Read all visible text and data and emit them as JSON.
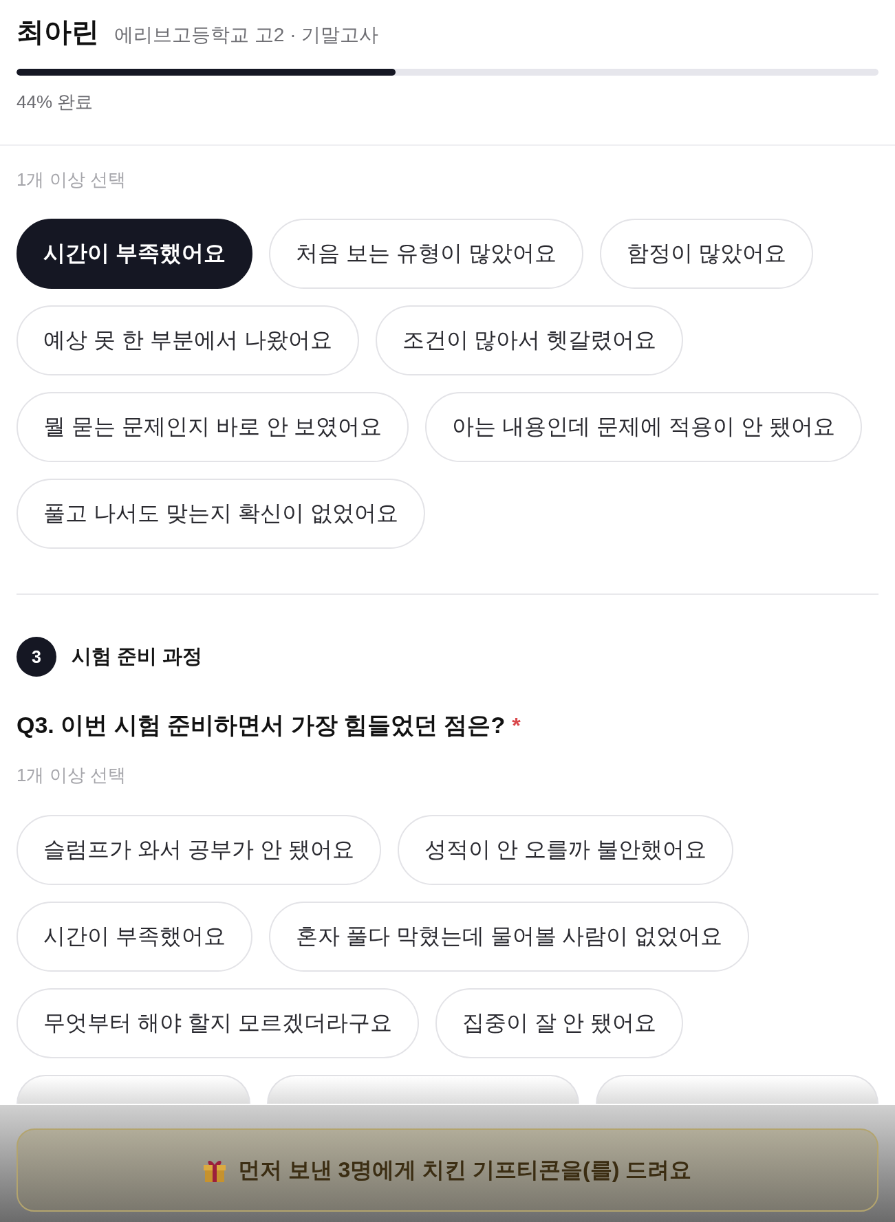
{
  "header": {
    "name": "최아린",
    "subtitle": "에리브고등학교 고2 · 기말고사",
    "progress": {
      "level": 0.44,
      "label": "44% 완료"
    }
  },
  "top_question": {
    "hint": "1개 이상 선택",
    "options": [
      {
        "label": "시간이 부족했어요",
        "selected": true
      },
      {
        "label": "처음 보는 유형이 많았어요",
        "selected": false
      },
      {
        "label": "함정이 많았어요",
        "selected": false
      },
      {
        "label": "예상 못 한 부분에서 나왔어요",
        "selected": false
      },
      {
        "label": "조건이 많아서 헷갈렸어요",
        "selected": false
      },
      {
        "label": "뭘 묻는 문제인지 바로 안 보였어요",
        "selected": false
      },
      {
        "label": "아는 내용인데 문제에 적용이 안 됐어요",
        "selected": false
      },
      {
        "label": "풀고 나서도 맞는지 확신이 없었어요",
        "selected": false
      }
    ]
  },
  "section": {
    "number": "3",
    "title": "시험 준비 과정",
    "question": {
      "title": "Q3. 이번 시험 준비하면서 가장 힘들었던 점은?",
      "required_mark": "*",
      "hint": "1개 이상 선택",
      "options": [
        {
          "label": "슬럼프가 와서 공부가 안 됐어요",
          "selected": false
        },
        {
          "label": "성적이 안 오를까 불안했어요",
          "selected": false
        },
        {
          "label": "시간이 부족했어요",
          "selected": false
        },
        {
          "label": "혼자 풀다 막혔는데 물어볼 사람이 없었어요",
          "selected": false
        },
        {
          "label": "무엇부터 해야 할지 모르겠더라구요",
          "selected": false
        },
        {
          "label": "집중이 잘 안 됐어요",
          "selected": false
        }
      ],
      "partially_hidden_options": [
        {
          "selected": false
        },
        {
          "selected": false
        },
        {
          "selected": false
        }
      ]
    }
  },
  "bottom_bar": {
    "button": "먼저 보낸 3명에게 치킨 기프티콘을(를) 드려요"
  }
}
